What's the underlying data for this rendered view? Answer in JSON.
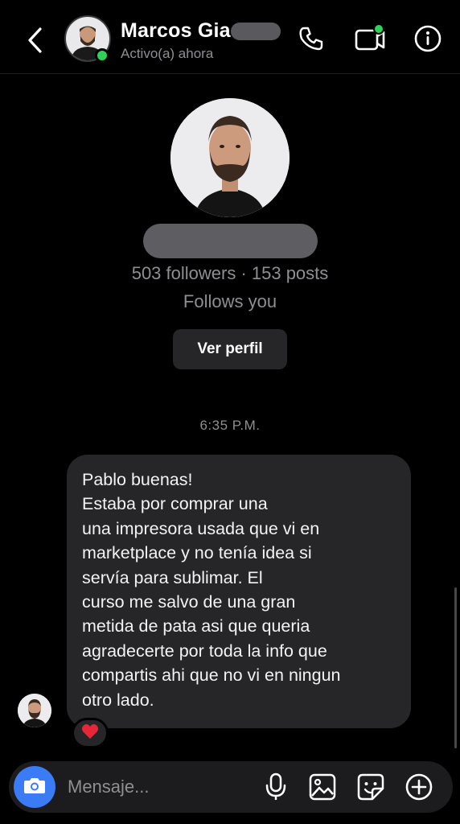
{
  "header": {
    "contact_name": "Marcos Gia",
    "status": "Activo(a) ahora",
    "icons": [
      "back-arrow-icon",
      "phone-icon",
      "video-call-icon",
      "info-icon"
    ],
    "online_color": "#2fd158"
  },
  "profile": {
    "stats": "503 followers · 153 posts",
    "follows_you": "Follows you",
    "view_profile_label": "Ver perfil"
  },
  "conversation": {
    "timestamp": "6:35 P.M.",
    "messages": [
      {
        "sender": "contact",
        "lines": [
          "Pablo buenas!",
          "Estaba por comprar una",
          "una impresora usada que vi en",
          "marketplace y no tenía idea si",
          "servía para sublimar. El",
          "curso me salvo de una gran",
          "metida de pata asi que queria",
          "agradecerte por toda la info que",
          "compartis ahi que no vi en ningun",
          "otro lado."
        ],
        "reaction": "❤️"
      }
    ]
  },
  "composer": {
    "placeholder": "Mensaje...",
    "camera_color": "#3b7bf6",
    "icons": [
      "camera-icon",
      "microphone-icon",
      "gallery-icon",
      "sticker-icon",
      "add-icon"
    ]
  }
}
